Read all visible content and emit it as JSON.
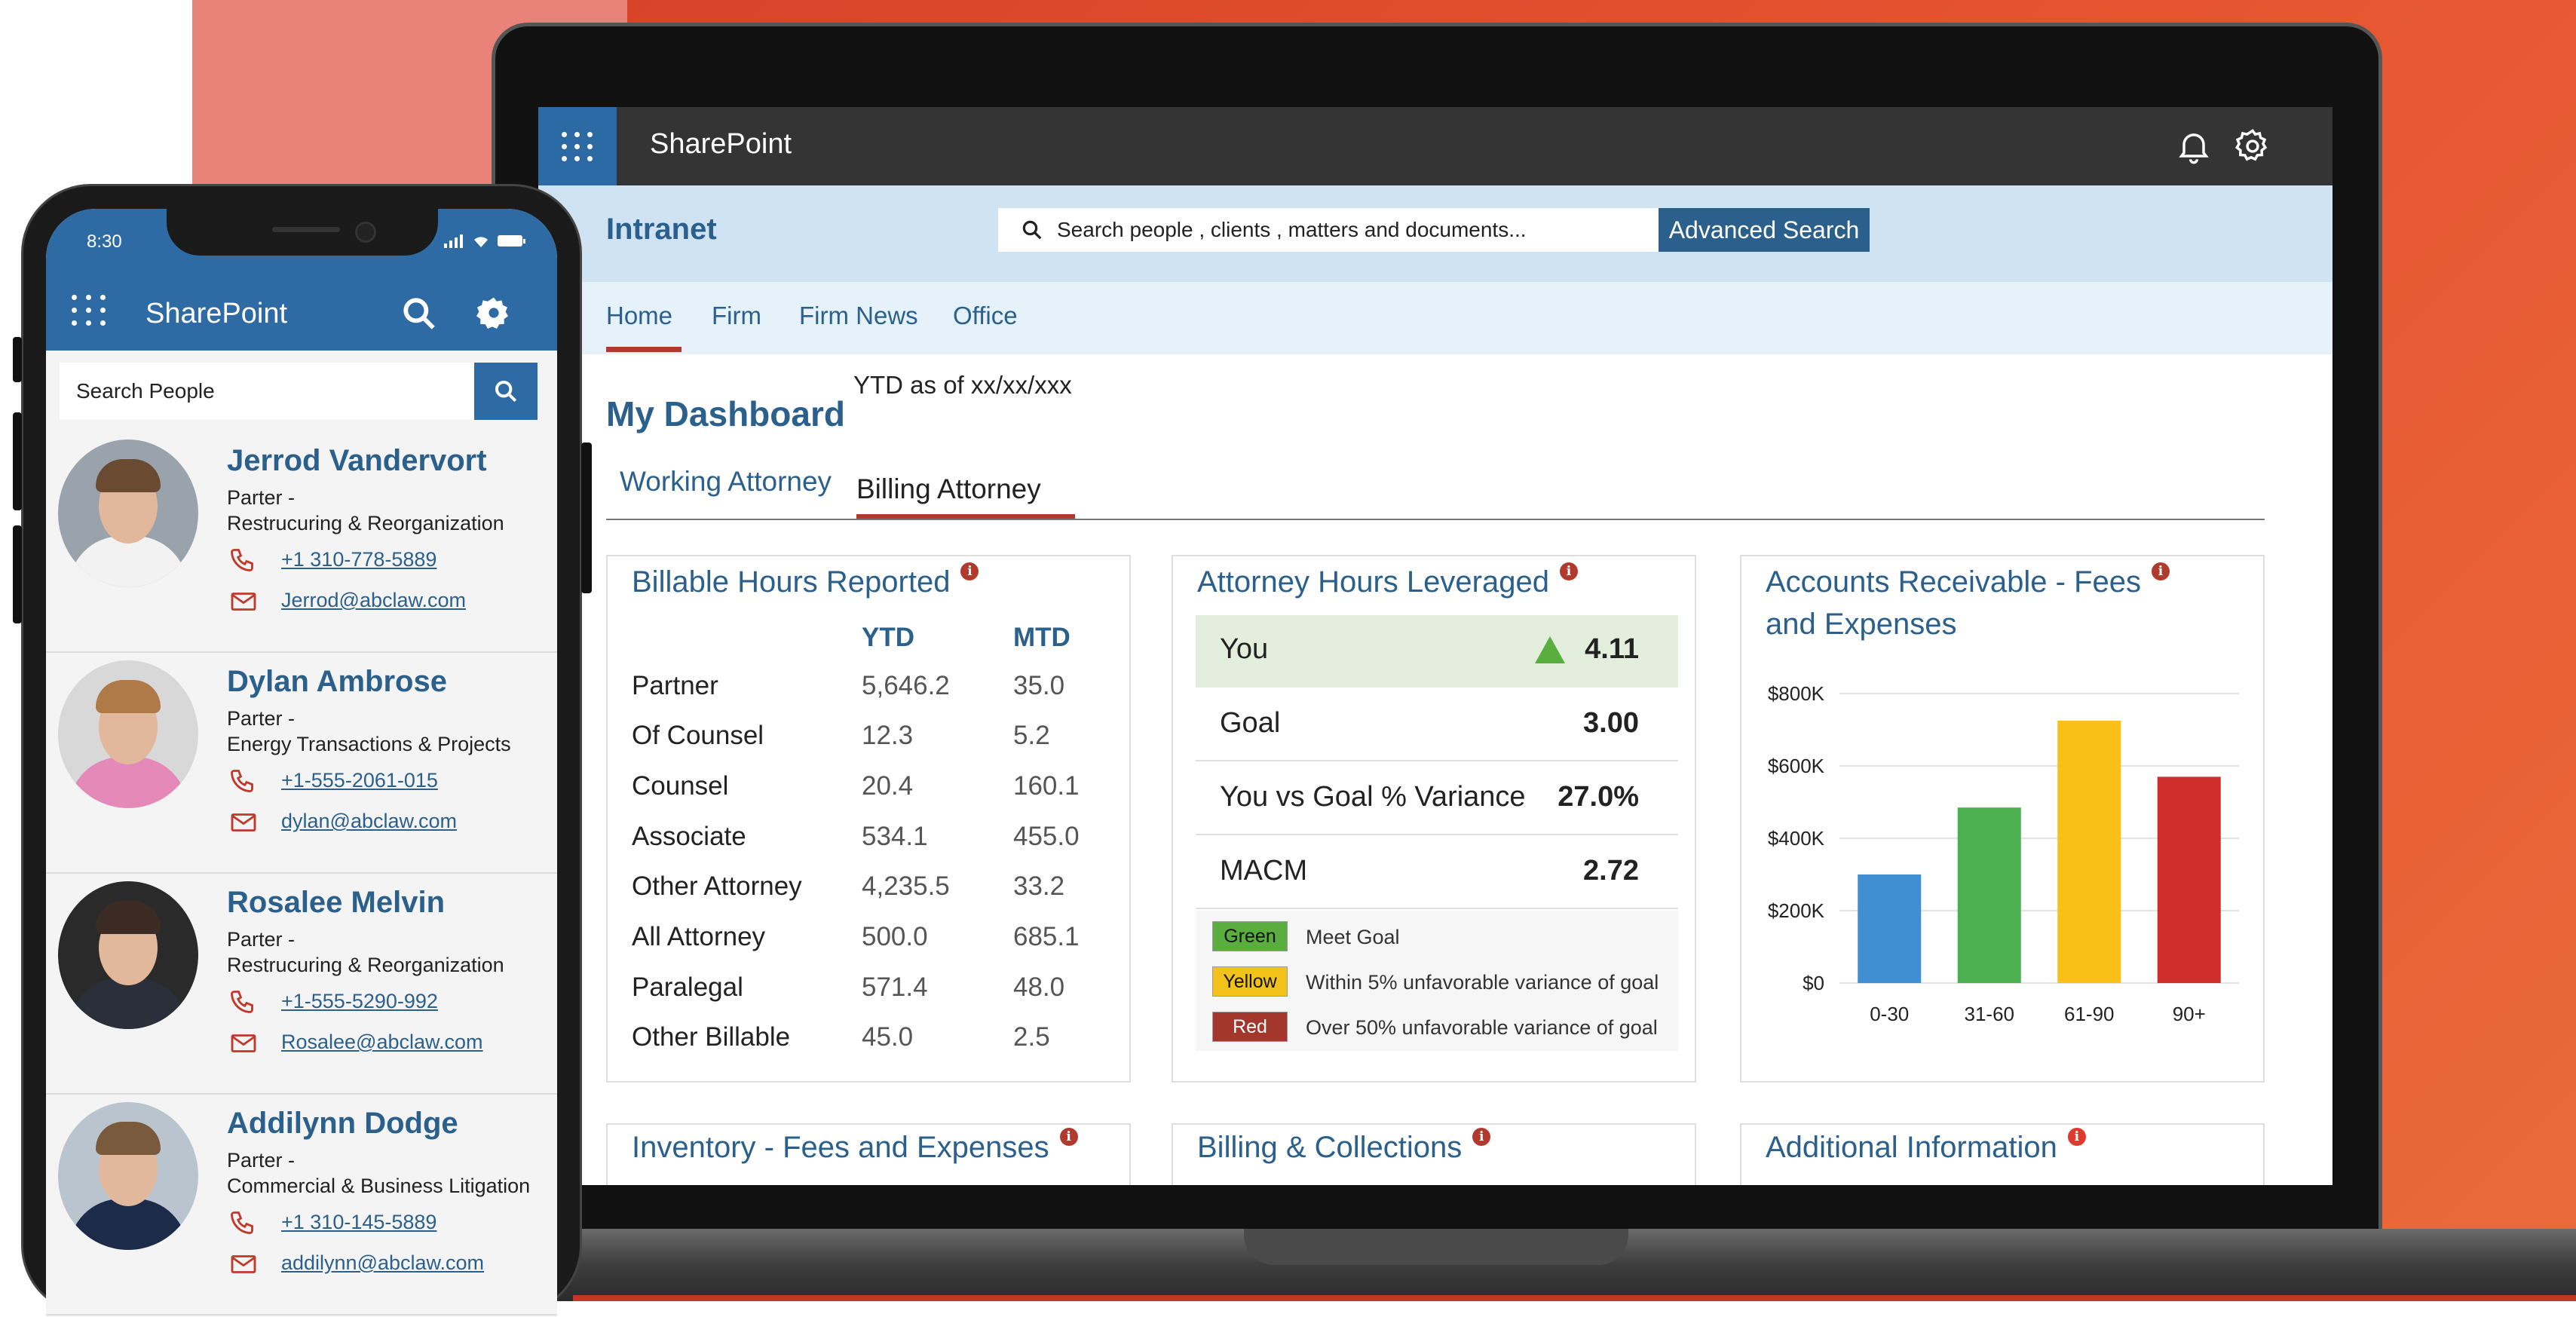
{
  "laptop": {
    "app_name": "SharePoint",
    "site_title": "Intranet",
    "search_placeholder": "Search people , clients , matters and documents...",
    "advanced_search_label": "Advanced Search",
    "nav": [
      "Home",
      "Firm",
      "Firm News",
      "Office"
    ],
    "active_nav": "Home",
    "dashboard_title": "My Dashboard",
    "ytd_note": "YTD as of xx/xx/xxx",
    "tabs": [
      "Working Attorney",
      "Billing Attorney"
    ],
    "active_tab": "Billing Attorney",
    "billable_hours": {
      "title": "Billable Hours Reported",
      "col_ytd": "YTD",
      "col_mtd": "MTD",
      "rows": [
        {
          "label": "Partner",
          "ytd": "5,646.2",
          "mtd": "35.0"
        },
        {
          "label": "Of Counsel",
          "ytd": "12.3",
          "mtd": "5.2"
        },
        {
          "label": "Counsel",
          "ytd": "20.4",
          "mtd": "160.1"
        },
        {
          "label": "Associate",
          "ytd": "534.1",
          "mtd": "455.0"
        },
        {
          "label": "Other Attorney",
          "ytd": "4,235.5",
          "mtd": "33.2"
        },
        {
          "label": "All Attorney",
          "ytd": "500.0",
          "mtd": "685.1"
        },
        {
          "label": "Paralegal",
          "ytd": "571.4",
          "mtd": "48.0"
        },
        {
          "label": "Other Billable",
          "ytd": "45.0",
          "mtd": "2.5"
        }
      ]
    },
    "attorney_hours": {
      "title": "Attorney Hours Leveraged",
      "rows": [
        {
          "label": "You",
          "value": "4.11"
        },
        {
          "label": "Goal",
          "value": "3.00"
        },
        {
          "label": "You vs Goal % Variance",
          "value": "27.0%"
        },
        {
          "label": "MACM",
          "value": "2.72"
        }
      ],
      "legend": [
        {
          "badge": "Green",
          "text": "Meet Goal",
          "color": "#5aae3e",
          "text_color": "#111111"
        },
        {
          "badge": "Yellow",
          "text": "Within 5% unfavorable variance of goal",
          "color": "#f3c21a",
          "text_color": "#111111"
        },
        {
          "badge": "Red",
          "text": "Over 50% unfavorable variance of goal",
          "color": "#a3372c",
          "text_color": "#ffffff"
        }
      ]
    },
    "accounts_receivable": {
      "title_line1": "Accounts Receivable - Fees",
      "title_line2": "and Expenses"
    },
    "bottom_cards": [
      "Inventory - Fees and Expenses",
      "Billing & Collections",
      "Additional Information"
    ],
    "info_glyph": "i"
  },
  "chart_data": {
    "type": "bar",
    "title": "Accounts Receivable - Fees and Expenses",
    "categories": [
      "0-30",
      "31-60",
      "61-90",
      "90+"
    ],
    "values": [
      300,
      485,
      725,
      570
    ],
    "unit": "$K",
    "colors": [
      "#3f8fd2",
      "#4cb050",
      "#f9c018",
      "#cf2d2b"
    ],
    "ylim": [
      0,
      800
    ],
    "yticks": [
      0,
      200,
      400,
      600,
      800
    ],
    "ytick_labels": [
      "$0",
      "$200K",
      "$400K",
      "$600K",
      "$800K"
    ],
    "grid": true
  },
  "phone": {
    "time": "8:30",
    "app_name": "SharePoint",
    "search_placeholder": "Search People",
    "people": [
      {
        "name": "Jerrod Vandervort",
        "title": "Parter -",
        "group": "Restrucuring & Reorganization",
        "phone": "+1 310-778-5889",
        "email": "Jerrod@abclaw.com",
        "avatar_bg": "#9aa3ab",
        "shirt": "#f2f2f2",
        "hair": "#6b4a32"
      },
      {
        "name": "Dylan Ambrose",
        "title": "Parter -",
        "group": "Energy Transactions & Projects",
        "phone": "+1-555-2061-015",
        "email": "dylan@abclaw.com",
        "avatar_bg": "#d8d8d8",
        "shirt": "#e58ab8",
        "hair": "#b07a48"
      },
      {
        "name": "Rosalee Melvin",
        "title": "Parter -",
        "group": "Restrucuring & Reorganization",
        "phone": "+1-555-5290-992",
        "email": "Rosalee@abclaw.com",
        "avatar_bg": "#2a2a2a",
        "shirt": "#2b2f3a",
        "hair": "#3b2b22"
      },
      {
        "name": "Addilynn Dodge",
        "title": "Parter -",
        "group": "Commercial & Business Litigation",
        "phone": "+1 310-145-5889",
        "email": "addilynn@abclaw.com",
        "avatar_bg": "#b9c4cf",
        "shirt": "#1d2b4a",
        "hair": "#7a5a3c"
      }
    ]
  }
}
